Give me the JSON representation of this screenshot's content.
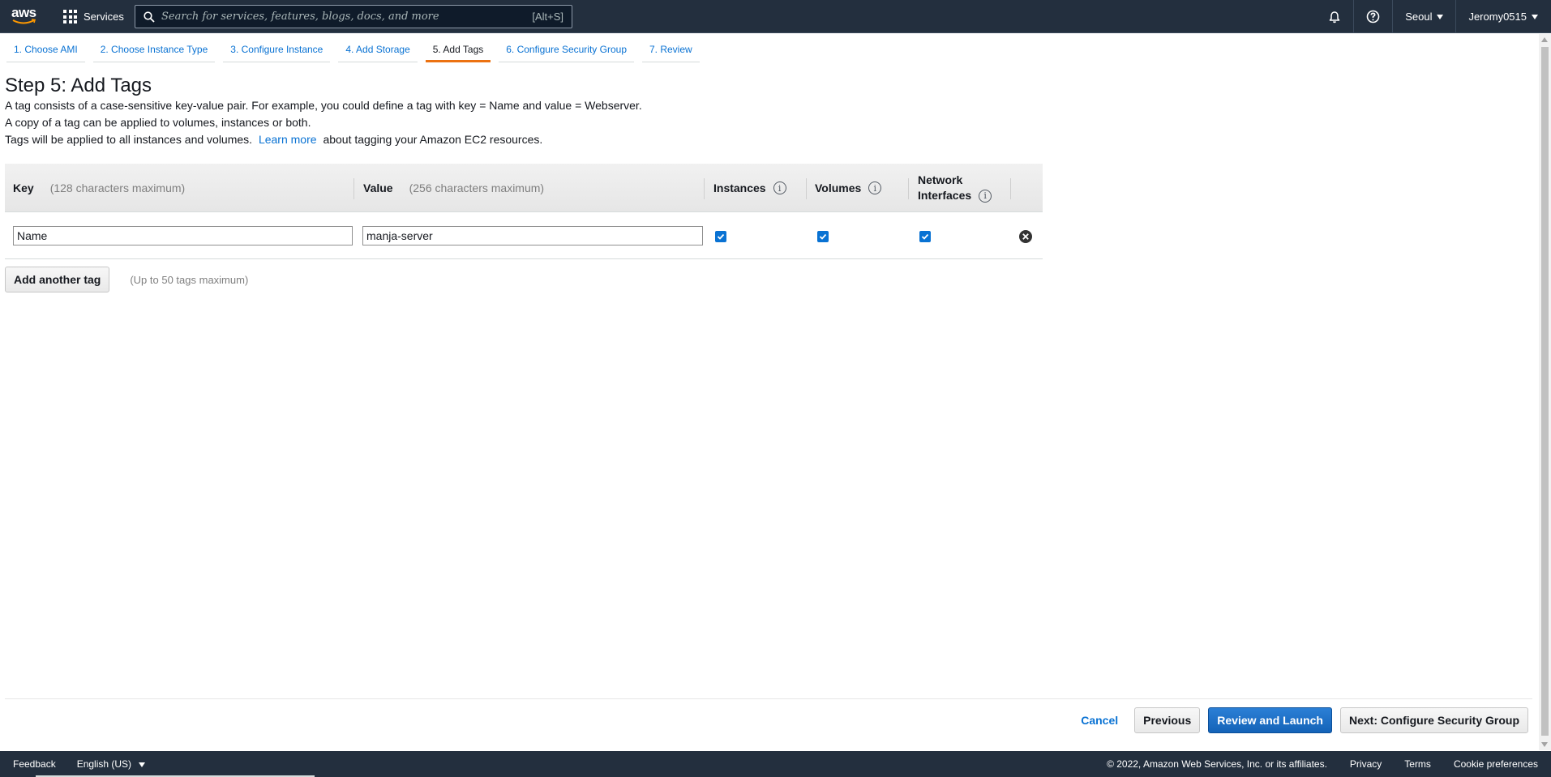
{
  "topbar": {
    "logo_text": "aws",
    "services_label": "Services",
    "search_placeholder": "Search for services, features, blogs, docs, and more",
    "search_shortcut": "[Alt+S]",
    "region": "Seoul",
    "account": "Jeromy0515"
  },
  "wizard": {
    "tabs": [
      {
        "label": "1. Choose AMI"
      },
      {
        "label": "2. Choose Instance Type"
      },
      {
        "label": "3. Configure Instance"
      },
      {
        "label": "4. Add Storage"
      },
      {
        "label": "5. Add Tags",
        "active": true
      },
      {
        "label": "6. Configure Security Group"
      },
      {
        "label": "7. Review"
      }
    ],
    "accent_color": "#ec7211"
  },
  "page": {
    "title": "Step 5: Add Tags",
    "line1": "A tag consists of a case-sensitive key-value pair. For example, you could define a tag with key = Name and value = Webserver.",
    "line2": "A copy of a tag can be applied to volumes, instances or both.",
    "line3_pre": "Tags will be applied to all instances and volumes.",
    "learn_more": "Learn more",
    "line3_post": "about tagging your Amazon EC2 resources."
  },
  "table": {
    "headers": {
      "key": "Key",
      "key_hint": "(128 characters maximum)",
      "value": "Value",
      "value_hint": "(256 characters maximum)",
      "instances": "Instances",
      "volumes": "Volumes",
      "network_line1": "Network",
      "network_line2": "Interfaces",
      "info_glyph": "i"
    },
    "rows": [
      {
        "key": "Name",
        "value": "manja-server",
        "instances": true,
        "volumes": true,
        "network_interfaces": true
      }
    ],
    "add_button": "Add another tag",
    "add_hint": "(Up to 50 tags maximum)"
  },
  "actions": {
    "cancel": "Cancel",
    "previous": "Previous",
    "review_launch": "Review and Launch",
    "next": "Next: Configure Security Group"
  },
  "footer": {
    "feedback": "Feedback",
    "language": "English (US)",
    "copyright": "© 2022, Amazon Web Services, Inc. or its affiliates.",
    "privacy": "Privacy",
    "terms": "Terms",
    "cookies": "Cookie preferences"
  }
}
